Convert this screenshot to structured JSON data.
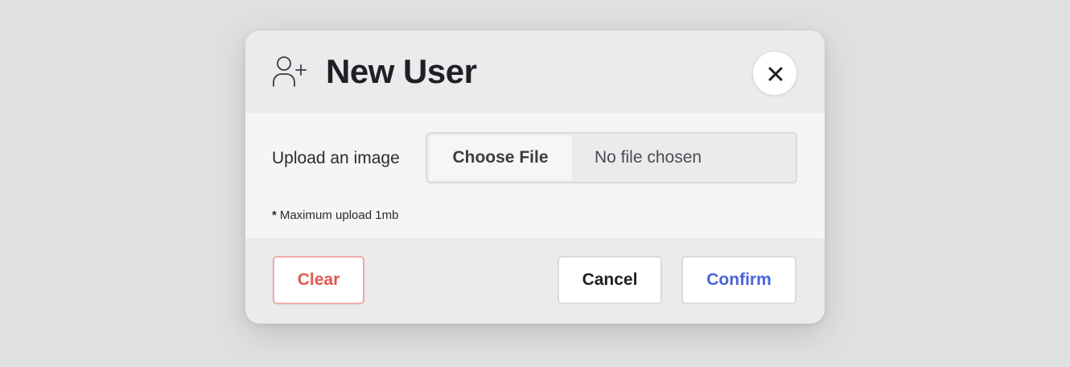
{
  "modal": {
    "title": "New User",
    "header_icon": "user-plus-icon",
    "close_icon": "close-icon"
  },
  "upload": {
    "label": "Upload an image",
    "choose_file_label": "Choose File",
    "file_status": "No file chosen",
    "note_marker": "*",
    "note_text": "Maximum upload 1mb"
  },
  "footer": {
    "clear_label": "Clear",
    "cancel_label": "Cancel",
    "confirm_label": "Confirm"
  },
  "colors": {
    "clear_text": "#e2574f",
    "clear_border": "#f0aaa6",
    "confirm_text": "#4a63d8",
    "title_text": "#1f2023"
  }
}
